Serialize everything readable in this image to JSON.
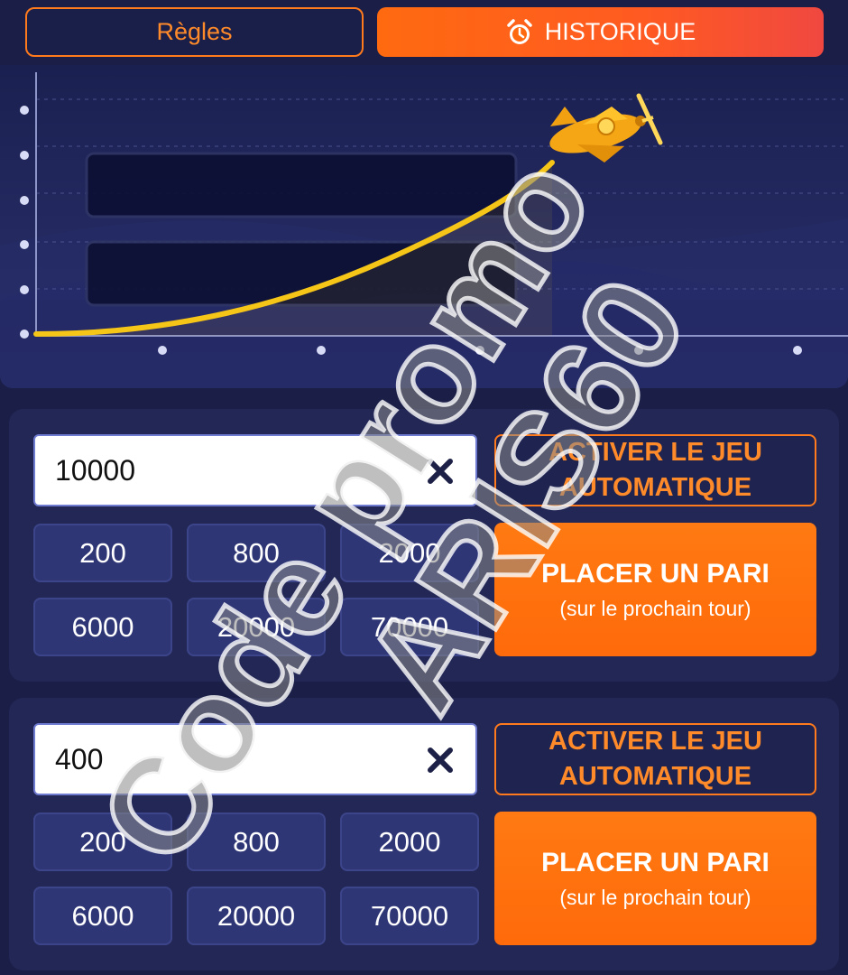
{
  "tabs": {
    "rules_label": "Règles",
    "history_label": "HISTORIQUE",
    "history_icon": "alarm-clock-icon"
  },
  "graph": {
    "plane_icon": "plane-icon"
  },
  "bet_panels": [
    {
      "amount": "10000",
      "clear_icon": "close-icon",
      "chips": [
        "200",
        "800",
        "2000",
        "6000",
        "20000",
        "70000"
      ],
      "auto_label_line1": "ACTIVER LE JEU",
      "auto_label_line2": "AUTOMATIQUE",
      "place_label": "PLACER UN PARI",
      "place_sublabel": "(sur le prochain tour)"
    },
    {
      "amount": "400",
      "clear_icon": "close-icon",
      "chips": [
        "200",
        "800",
        "2000",
        "6000",
        "20000",
        "70000"
      ],
      "auto_label_line1": "ACTIVER LE JEU",
      "auto_label_line2": "AUTOMATIQUE",
      "place_label": "PLACER UN PARI",
      "place_sublabel": "(sur le prochain tour)"
    }
  ],
  "watermark": {
    "line1": "Code promo",
    "line2": "ARIS60"
  },
  "colors": {
    "accent": "#ff7a1c",
    "background": "#1b1f48",
    "curve": "#f5c518"
  }
}
